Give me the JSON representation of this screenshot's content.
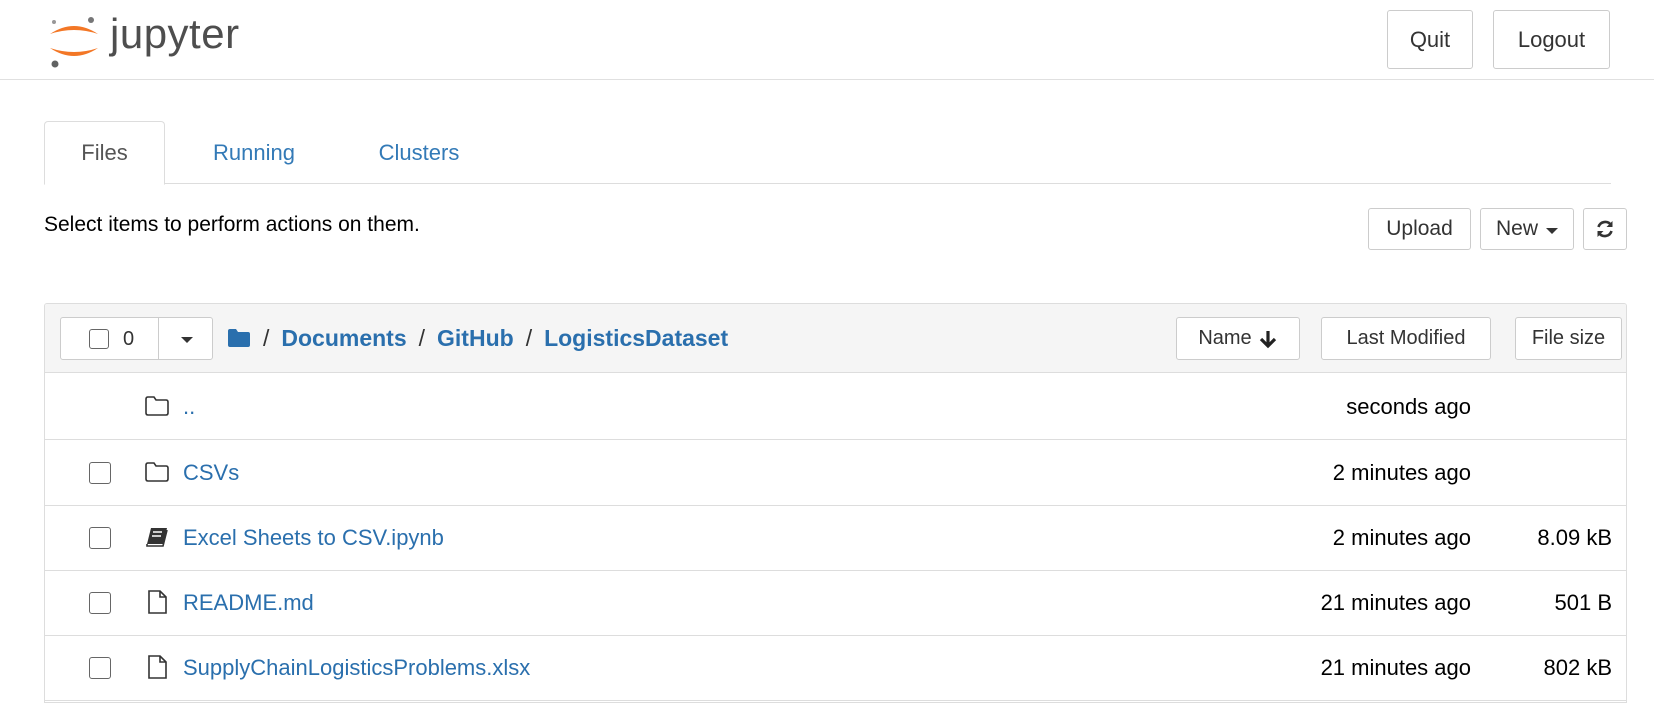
{
  "app": {
    "logo_text": "jupyter",
    "quit_label": "Quit",
    "logout_label": "Logout"
  },
  "tabs": [
    {
      "label": "Files",
      "active": true
    },
    {
      "label": "Running",
      "active": false
    },
    {
      "label": "Clusters",
      "active": false
    }
  ],
  "toolbar": {
    "help_text": "Select items to perform actions on them.",
    "upload_label": "Upload",
    "new_label": "New"
  },
  "list_header": {
    "selected_count": "0",
    "breadcrumb": [
      "Documents",
      "GitHub",
      "LogisticsDataset"
    ],
    "separator": "/",
    "sort_name_label": "Name",
    "sort_modified_label": "Last Modified",
    "sort_size_label": "File size"
  },
  "rows": [
    {
      "name": "..",
      "type": "folder",
      "modified": "seconds ago",
      "size": "",
      "checkbox": false
    },
    {
      "name": "CSVs",
      "type": "folder",
      "modified": "2 minutes ago",
      "size": "",
      "checkbox": true
    },
    {
      "name": "Excel Sheets to CSV.ipynb",
      "type": "notebook",
      "modified": "2 minutes ago",
      "size": "8.09 kB",
      "checkbox": true
    },
    {
      "name": "README.md",
      "type": "file",
      "modified": "21 minutes ago",
      "size": "501 B",
      "checkbox": true
    },
    {
      "name": "SupplyChainLogisticsProblems.xlsx",
      "type": "file",
      "modified": "21 minutes ago",
      "size": "802 kB",
      "checkbox": true
    }
  ],
  "colors": {
    "link": "#2a6fad",
    "logo_orange": "#f37726",
    "logo_gray": "#616262"
  }
}
